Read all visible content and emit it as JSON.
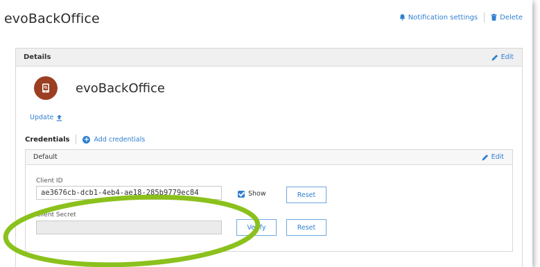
{
  "header": {
    "app_title": "evoBackOffice",
    "notification_label": "Notification settings",
    "delete_label": "Delete"
  },
  "details": {
    "title": "Details",
    "edit_label": "Edit",
    "app_name": "evoBackOffice",
    "update_label": "Update"
  },
  "credentials": {
    "label": "Credentials",
    "add_label": "Add credentials",
    "card": {
      "title": "Default",
      "edit_label": "Edit",
      "client_id_label": "Client ID",
      "client_id_value": "ae3676cb-dcb1-4eb4-ae18-285b9779ec84",
      "show_label": "Show",
      "show_checked": true,
      "reset_label": "Reset",
      "client_secret_label": "Client Secret",
      "client_secret_value": "",
      "verify_label": "Verify",
      "reset2_label": "Reset"
    }
  },
  "colors": {
    "accent": "#2f7fd0",
    "avatar": "#9b3e22",
    "highlight": "#8bc11c"
  },
  "icons": [
    "bell-icon",
    "trash-icon",
    "pencil-icon",
    "phone-app-icon",
    "upload-icon",
    "plus-circle-icon",
    "checkbox-icon"
  ]
}
